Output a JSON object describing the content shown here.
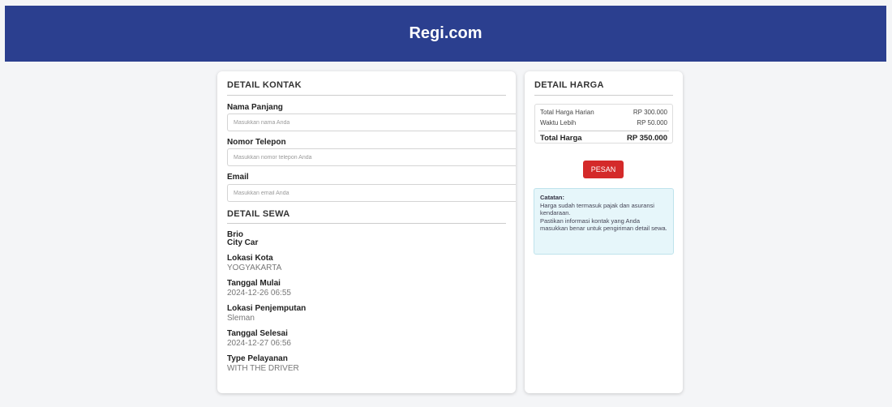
{
  "header": {
    "brand": "Regi.com"
  },
  "contact": {
    "title": "DETAIL KONTAK",
    "name_label": "Nama Panjang",
    "name_placeholder": "Masukkan nama Anda",
    "phone_label": "Nomor Telepon",
    "phone_placeholder": "Masukkan nomor telepon Anda",
    "email_label": "Email",
    "email_placeholder": "Masukkan email Anda"
  },
  "rental": {
    "title": "DETAIL SEWA",
    "car_name": "Brio",
    "car_type": "City Car",
    "fields": [
      {
        "label": "Lokasi Kota",
        "value": "YOGYAKARTA"
      },
      {
        "label": "Tanggal Mulai",
        "value": "2024-12-26 06:55"
      },
      {
        "label": "Lokasi Penjemputan",
        "value": "Sleman"
      },
      {
        "label": "Tanggal Selesai",
        "value": "2024-12-27 06:56"
      },
      {
        "label": "Type Pelayanan",
        "value": "WITH THE DRIVER"
      }
    ]
  },
  "pricing": {
    "title": "DETAIL HARGA",
    "daily_label": "Total Harga Harian",
    "daily_value": "RP 300.000",
    "overtime_label": "Waktu Lebih",
    "overtime_value": "RP 50.000",
    "total_label": "Total Harga",
    "total_value": "RP 350.000",
    "order_button": "PESAN"
  },
  "note": {
    "title": "Catatan:",
    "line1": "Harga sudah termasuk pajak dan asuransi kendaraan.",
    "line2": "Pastikan informasi kontak yang Anda masukkan benar untuk pengiriman detail sewa."
  },
  "colors": {
    "header_bg": "#2b3f8f",
    "button_bg": "#d42a2a",
    "note_bg": "#e6f6fa"
  }
}
